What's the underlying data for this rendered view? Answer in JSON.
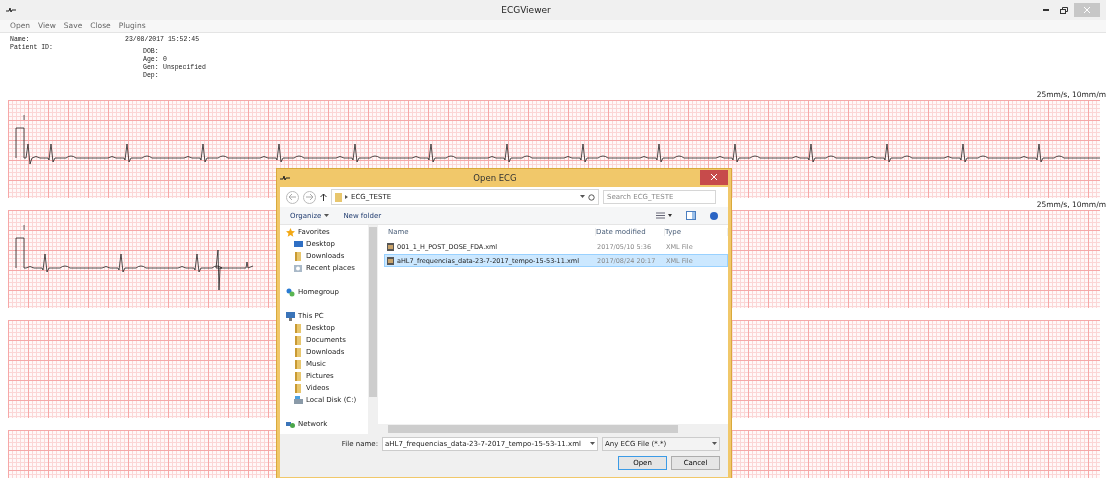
{
  "window": {
    "title": "ECGViewer"
  },
  "menu": [
    "Open",
    "View",
    "Save",
    "Close",
    "Plugins"
  ],
  "patient": {
    "name_label": "Name:",
    "id_label": "Patient ID:",
    "datetime": "23/08/2017 15:52:45",
    "fields": [
      {
        "label": "DOB:"
      },
      {
        "label": "Age:",
        "value": "0"
      },
      {
        "label": "Gen:",
        "value": "Unspecified"
      },
      {
        "label": "Dep:"
      }
    ]
  },
  "strips": [
    {
      "kind": "full",
      "scale": "25mm/s, 10mm/m",
      "lead": "I"
    },
    {
      "kind": "short",
      "scale": "25mm/s, 10mm/m",
      "lead": "I"
    },
    {
      "kind": "empty"
    },
    {
      "kind": "empty"
    }
  ],
  "dialog": {
    "title": "Open ECG",
    "path": "ECG_TESTE",
    "search": {
      "placeholder": "Search ECG_TESTE"
    },
    "toolbar": [
      "Organize",
      "New folder"
    ],
    "nav": [
      {
        "label": "Favorites",
        "kind": "star",
        "children": [
          {
            "label": "Desktop",
            "kind": "desktop"
          },
          {
            "label": "Downloads",
            "kind": "folder"
          },
          {
            "label": "Recent places",
            "kind": "recent"
          }
        ]
      },
      {
        "label": "Homegroup",
        "kind": "homegroup"
      },
      {
        "label": "This PC",
        "kind": "pc",
        "children": [
          {
            "label": "Desktop",
            "kind": "folder"
          },
          {
            "label": "Documents",
            "kind": "folder"
          },
          {
            "label": "Downloads",
            "kind": "folder"
          },
          {
            "label": "Music",
            "kind": "folder"
          },
          {
            "label": "Pictures",
            "kind": "folder"
          },
          {
            "label": "Videos",
            "kind": "folder"
          },
          {
            "label": "Local Disk (C:)",
            "kind": "disk"
          }
        ]
      },
      {
        "label": "Network",
        "kind": "network"
      }
    ],
    "columns": [
      "Name",
      "Date modified",
      "Type"
    ],
    "files": [
      {
        "name": "001_1_H_POST_DOSE_FDA.xml",
        "date": "2017/05/10 5:36",
        "type": "XML File",
        "selected": false
      },
      {
        "name": "aHL7_frequencias_data-23-7-2017_tempo-15-53-11.xml",
        "date": "2017/08/24 20:17",
        "type": "XML File",
        "selected": true
      }
    ],
    "file_name_label": "File name:",
    "file_name": "aHL7_frequencias_data-23-7-2017_tempo-15-53-11.xml",
    "file_type": "Any ECG File (*.*)",
    "buttons": [
      "Open",
      "Cancel"
    ]
  }
}
